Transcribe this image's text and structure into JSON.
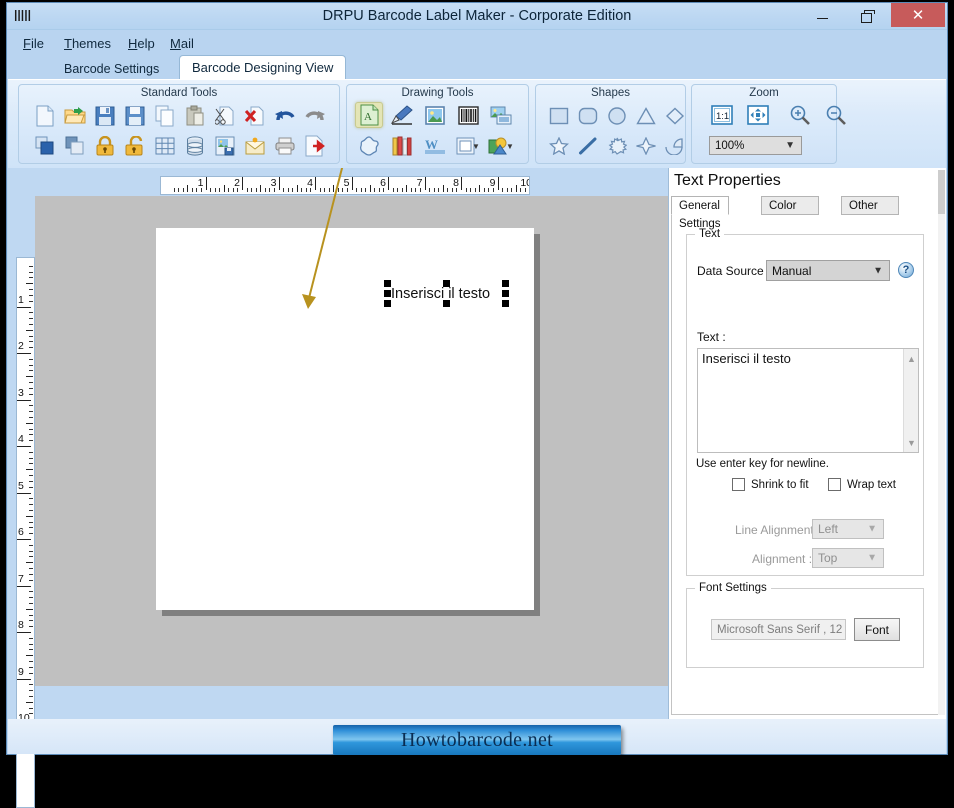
{
  "window": {
    "title": "DRPU Barcode Label Maker - Corporate Edition",
    "app_icon": "barcode-icon",
    "minimize_label": "–",
    "maximize_label": "❐",
    "close_label": "✕"
  },
  "menu": {
    "items": [
      {
        "label": "File",
        "accel": "F",
        "rest": "ile"
      },
      {
        "label": "Themes",
        "accel": "T",
        "rest": "hemes"
      },
      {
        "label": "Help",
        "accel": "H",
        "rest": "elp"
      },
      {
        "label": "Mail",
        "accel": "M",
        "rest": "ail"
      }
    ]
  },
  "tabs": [
    {
      "label": "Barcode Settings",
      "active": false
    },
    {
      "label": "Barcode Designing View",
      "active": true
    }
  ],
  "ribbon": {
    "groups": [
      {
        "title": "Standard Tools",
        "tools": [
          "new-document-icon",
          "open-folder-icon",
          "save-icon",
          "save-as-icon",
          "copy-icon",
          "paste-icon",
          "cut-icon",
          "delete-icon",
          "undo-icon",
          "redo-icon",
          "bring-to-front-icon",
          "send-to-back-icon",
          "lock-icon",
          "unlock-icon",
          "grid-icon",
          "database-icon",
          "export-image-icon",
          "email-icon",
          "print-icon",
          "exit-icon"
        ]
      },
      {
        "title": "Drawing Tools",
        "tools": [
          "text-tool-icon",
          "signature-tool-icon",
          "picture-tool-icon",
          "barcode-tool-icon",
          "image-frame-icon",
          "star-shape-icon",
          "library-icon",
          "watermark-icon",
          "frame-dropdown-icon",
          "symbol-dropdown-icon"
        ],
        "selected": "text-tool-icon"
      },
      {
        "title": "Shapes",
        "tools": [
          "rectangle-icon",
          "rounded-rectangle-icon",
          "ellipse-icon",
          "triangle-icon",
          "diamond-icon",
          "star-icon",
          "line-icon",
          "burst-icon",
          "four-point-star-icon",
          "pie-icon"
        ]
      },
      {
        "title": "Zoom",
        "tools": [
          "actual-size-icon",
          "fit-to-window-icon",
          "zoom-in-icon",
          "zoom-out-icon"
        ],
        "zoom_value": "100%"
      }
    ]
  },
  "canvas": {
    "ruler_h_labels": [
      "1",
      "2",
      "3",
      "4",
      "5",
      "6",
      "7",
      "8",
      "9",
      "10"
    ],
    "ruler_v_labels": [
      "1",
      "2",
      "3",
      "4",
      "5",
      "6",
      "7",
      "8",
      "9",
      "10"
    ],
    "object_text": "Inserisci il testo",
    "annotation": "arrow-from-text-tool-to-object"
  },
  "properties": {
    "title": "Text Properties",
    "tabs": [
      {
        "label": "General Settings",
        "active": true
      },
      {
        "label": "Color Settings",
        "active": false
      },
      {
        "label": "Other Settings",
        "active": false
      }
    ],
    "text_group": {
      "legend": "Text",
      "data_source_label": "Data Source :",
      "data_source_value": "Manual",
      "help_label": "?",
      "text_label": "Text :",
      "text_value": "Inserisci il testo",
      "hint": "Use enter key for newline.",
      "shrink_to_fit_label": "Shrink to fit",
      "shrink_to_fit_checked": false,
      "wrap_text_label": "Wrap text",
      "wrap_text_checked": false,
      "line_alignment_label": "Line Alignment",
      "line_alignment_value": "Left",
      "alignment_label": "Alignment :",
      "alignment_value": "Top"
    },
    "font_group": {
      "legend": "Font Settings",
      "font_value": "Microsoft Sans Serif , 12",
      "font_button": "Font"
    }
  },
  "watermark": {
    "text": "Howtobarcode.net"
  },
  "colors": {
    "title_bar": "#bcd7f2",
    "close_button": "#c75b5b",
    "ribbon": "#dbeafa",
    "canvas_bg": "#c0c0c0",
    "page": "#ffffff",
    "selected_tool": "#e4e5b6",
    "annotation_arrow": "#b8921f",
    "watermark_blue": "#2f8fd8"
  }
}
